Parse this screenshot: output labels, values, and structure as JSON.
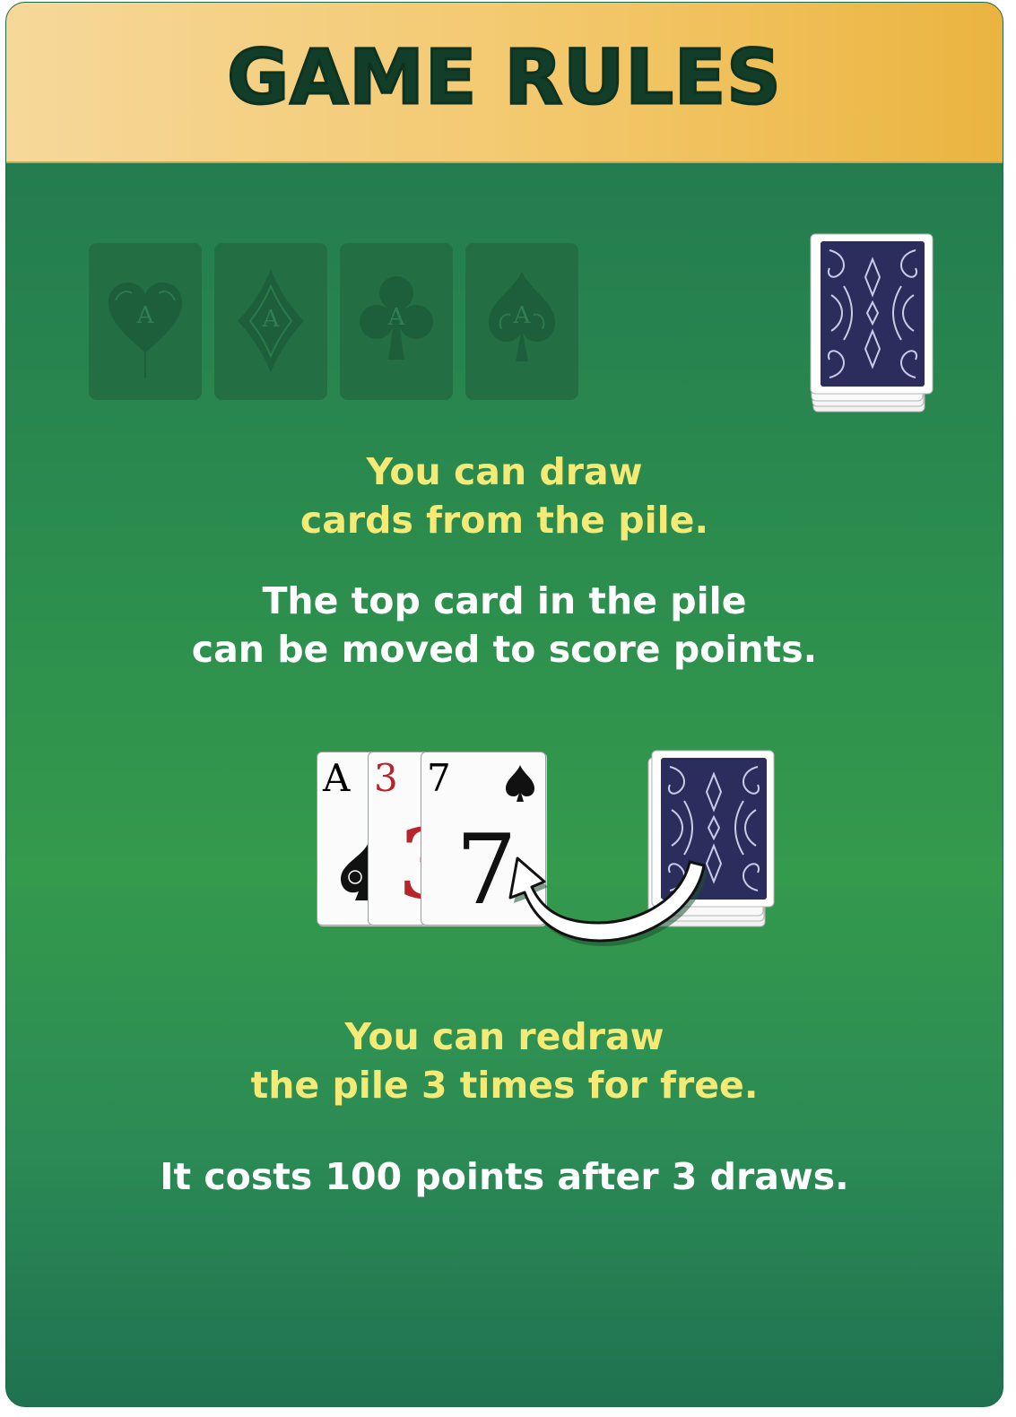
{
  "header": {
    "title": "GAME RULES"
  },
  "foundations": [
    {
      "suit": "hearts",
      "letter": "A"
    },
    {
      "suit": "diamonds",
      "letter": "A"
    },
    {
      "suit": "clubs",
      "letter": "A"
    },
    {
      "suit": "spades",
      "letter": "A"
    }
  ],
  "rules": {
    "draw_line1": "You can draw",
    "draw_line2": "cards from the pile.",
    "top_line1": "The top card in the pile",
    "top_line2": "can be moved to score points.",
    "redraw_line1": "You can redraw",
    "redraw_line2": "the pile 3 times for free.",
    "cost_line": "It costs 100 points after 3 draws."
  },
  "waste_cards": [
    {
      "rank": "A",
      "suit": "spades",
      "color": "#111111"
    },
    {
      "rank": "3",
      "suit": "hearts",
      "color": "#b5252b"
    },
    {
      "rank": "7",
      "suit": "spades",
      "color": "#111111"
    }
  ],
  "colors": {
    "header_left": "#f6d89a",
    "header_right": "#ebb440",
    "felt": "#2a8a4e",
    "highlight_text": "#f4ea75",
    "card_back": "#2b2d5c"
  }
}
